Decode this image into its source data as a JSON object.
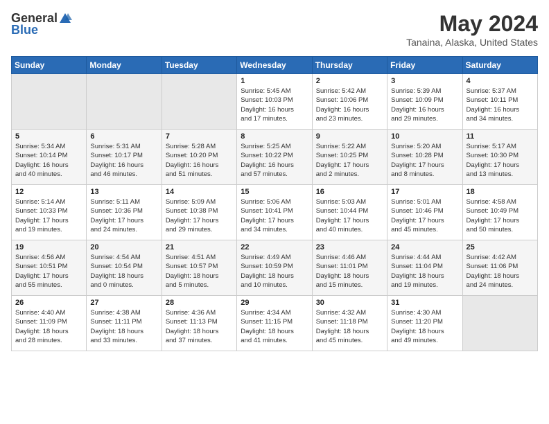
{
  "header": {
    "logo_general": "General",
    "logo_blue": "Blue",
    "title": "May 2024",
    "subtitle": "Tanaina, Alaska, United States"
  },
  "days_of_week": [
    "Sunday",
    "Monday",
    "Tuesday",
    "Wednesday",
    "Thursday",
    "Friday",
    "Saturday"
  ],
  "weeks": [
    [
      {
        "day": "",
        "info": ""
      },
      {
        "day": "",
        "info": ""
      },
      {
        "day": "",
        "info": ""
      },
      {
        "day": "1",
        "info": "Sunrise: 5:45 AM\nSunset: 10:03 PM\nDaylight: 16 hours\nand 17 minutes."
      },
      {
        "day": "2",
        "info": "Sunrise: 5:42 AM\nSunset: 10:06 PM\nDaylight: 16 hours\nand 23 minutes."
      },
      {
        "day": "3",
        "info": "Sunrise: 5:39 AM\nSunset: 10:09 PM\nDaylight: 16 hours\nand 29 minutes."
      },
      {
        "day": "4",
        "info": "Sunrise: 5:37 AM\nSunset: 10:11 PM\nDaylight: 16 hours\nand 34 minutes."
      }
    ],
    [
      {
        "day": "5",
        "info": "Sunrise: 5:34 AM\nSunset: 10:14 PM\nDaylight: 16 hours\nand 40 minutes."
      },
      {
        "day": "6",
        "info": "Sunrise: 5:31 AM\nSunset: 10:17 PM\nDaylight: 16 hours\nand 46 minutes."
      },
      {
        "day": "7",
        "info": "Sunrise: 5:28 AM\nSunset: 10:20 PM\nDaylight: 16 hours\nand 51 minutes."
      },
      {
        "day": "8",
        "info": "Sunrise: 5:25 AM\nSunset: 10:22 PM\nDaylight: 16 hours\nand 57 minutes."
      },
      {
        "day": "9",
        "info": "Sunrise: 5:22 AM\nSunset: 10:25 PM\nDaylight: 17 hours\nand 2 minutes."
      },
      {
        "day": "10",
        "info": "Sunrise: 5:20 AM\nSunset: 10:28 PM\nDaylight: 17 hours\nand 8 minutes."
      },
      {
        "day": "11",
        "info": "Sunrise: 5:17 AM\nSunset: 10:30 PM\nDaylight: 17 hours\nand 13 minutes."
      }
    ],
    [
      {
        "day": "12",
        "info": "Sunrise: 5:14 AM\nSunset: 10:33 PM\nDaylight: 17 hours\nand 19 minutes."
      },
      {
        "day": "13",
        "info": "Sunrise: 5:11 AM\nSunset: 10:36 PM\nDaylight: 17 hours\nand 24 minutes."
      },
      {
        "day": "14",
        "info": "Sunrise: 5:09 AM\nSunset: 10:38 PM\nDaylight: 17 hours\nand 29 minutes."
      },
      {
        "day": "15",
        "info": "Sunrise: 5:06 AM\nSunset: 10:41 PM\nDaylight: 17 hours\nand 34 minutes."
      },
      {
        "day": "16",
        "info": "Sunrise: 5:03 AM\nSunset: 10:44 PM\nDaylight: 17 hours\nand 40 minutes."
      },
      {
        "day": "17",
        "info": "Sunrise: 5:01 AM\nSunset: 10:46 PM\nDaylight: 17 hours\nand 45 minutes."
      },
      {
        "day": "18",
        "info": "Sunrise: 4:58 AM\nSunset: 10:49 PM\nDaylight: 17 hours\nand 50 minutes."
      }
    ],
    [
      {
        "day": "19",
        "info": "Sunrise: 4:56 AM\nSunset: 10:51 PM\nDaylight: 17 hours\nand 55 minutes."
      },
      {
        "day": "20",
        "info": "Sunrise: 4:54 AM\nSunset: 10:54 PM\nDaylight: 18 hours\nand 0 minutes."
      },
      {
        "day": "21",
        "info": "Sunrise: 4:51 AM\nSunset: 10:57 PM\nDaylight: 18 hours\nand 5 minutes."
      },
      {
        "day": "22",
        "info": "Sunrise: 4:49 AM\nSunset: 10:59 PM\nDaylight: 18 hours\nand 10 minutes."
      },
      {
        "day": "23",
        "info": "Sunrise: 4:46 AM\nSunset: 11:01 PM\nDaylight: 18 hours\nand 15 minutes."
      },
      {
        "day": "24",
        "info": "Sunrise: 4:44 AM\nSunset: 11:04 PM\nDaylight: 18 hours\nand 19 minutes."
      },
      {
        "day": "25",
        "info": "Sunrise: 4:42 AM\nSunset: 11:06 PM\nDaylight: 18 hours\nand 24 minutes."
      }
    ],
    [
      {
        "day": "26",
        "info": "Sunrise: 4:40 AM\nSunset: 11:09 PM\nDaylight: 18 hours\nand 28 minutes."
      },
      {
        "day": "27",
        "info": "Sunrise: 4:38 AM\nSunset: 11:11 PM\nDaylight: 18 hours\nand 33 minutes."
      },
      {
        "day": "28",
        "info": "Sunrise: 4:36 AM\nSunset: 11:13 PM\nDaylight: 18 hours\nand 37 minutes."
      },
      {
        "day": "29",
        "info": "Sunrise: 4:34 AM\nSunset: 11:15 PM\nDaylight: 18 hours\nand 41 minutes."
      },
      {
        "day": "30",
        "info": "Sunrise: 4:32 AM\nSunset: 11:18 PM\nDaylight: 18 hours\nand 45 minutes."
      },
      {
        "day": "31",
        "info": "Sunrise: 4:30 AM\nSunset: 11:20 PM\nDaylight: 18 hours\nand 49 minutes."
      },
      {
        "day": "",
        "info": ""
      }
    ]
  ]
}
